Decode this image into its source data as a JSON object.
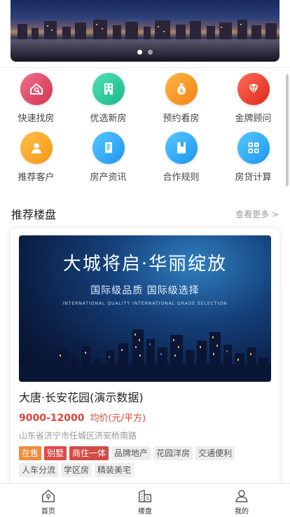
{
  "banner": {
    "slide_count": 2,
    "active_slide": 1
  },
  "grid": [
    {
      "label": "快速找房",
      "icon": "house-search-icon",
      "color_from": "#f1708a",
      "color_to": "#d2334f"
    },
    {
      "label": "优选新房",
      "icon": "building-icon",
      "color_from": "#54e0b6",
      "color_to": "#18b98a"
    },
    {
      "label": "预约看房",
      "icon": "money-bag-icon",
      "color_from": "#ffb547",
      "color_to": "#f28412"
    },
    {
      "label": "金牌顾问",
      "icon": "diamond-icon",
      "color_from": "#ff6e5a",
      "color_to": "#e0261a"
    },
    {
      "label": "推荐客户",
      "icon": "user-icon",
      "color_from": "#ffbd4a",
      "color_to": "#f59a14"
    },
    {
      "label": "房产资讯",
      "icon": "document-icon",
      "color_from": "#58c8ff",
      "color_to": "#1c95f0"
    },
    {
      "label": "合作规则",
      "icon": "bookmark-book-icon",
      "color_from": "#58c8ff",
      "color_to": "#1c95f0"
    },
    {
      "label": "房贷计算",
      "icon": "calculator-icon",
      "color_from": "#58c8ff",
      "color_to": "#1c95f0"
    }
  ],
  "section": {
    "title": "推荐楼盘",
    "more": "查看更多 >"
  },
  "property": {
    "image_slogan": "大城将启·华丽绽放",
    "image_sub": "国际级品质  国际级选择",
    "image_tiny": "INTERNATIONAL QUALITY  INTERNATIONAL GRADE SELECTION",
    "name": "大唐·长安花园(演示数据)",
    "price": "9000-12000",
    "price_unit": "均价(元/平方)",
    "address": "山东省济宁市任城区济安桥南路",
    "tags": [
      {
        "text": "在售",
        "style": "orange"
      },
      {
        "text": "别墅",
        "style": "red"
      },
      {
        "text": "商住一体",
        "style": "brick"
      },
      {
        "text": "品牌地产",
        "style": "plain"
      },
      {
        "text": "花园洋房",
        "style": "plain"
      },
      {
        "text": "交通便利",
        "style": "plain"
      },
      {
        "text": "人车分流",
        "style": "plain"
      },
      {
        "text": "学区房",
        "style": "plain"
      },
      {
        "text": "精装美宅",
        "style": "plain"
      }
    ]
  },
  "tabbar": [
    {
      "label": "首页",
      "icon": "home-icon"
    },
    {
      "label": "楼盘",
      "icon": "buildings-icon"
    },
    {
      "label": "我的",
      "icon": "person-icon"
    }
  ]
}
